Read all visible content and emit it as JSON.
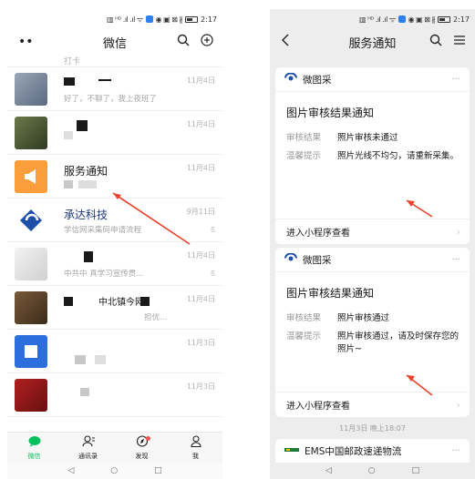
{
  "status": {
    "left_icons": "▥ ᴴᴰ .ıl .ıl ᯤ",
    "right_icons": "◉ ▣ ⊠ ∦",
    "battery": "",
    "time": "2:17"
  },
  "left": {
    "title": "微信",
    "menu_icon": "••",
    "partial_top_text": "打卡",
    "chats": [
      {
        "name": "",
        "preview": "好了，不聊了，我上夜班了",
        "time": "11月4日",
        "muted": false
      },
      {
        "name": "",
        "preview": "",
        "time": "11月4日",
        "muted": false
      },
      {
        "name": "服务通知",
        "preview": "",
        "time": "11月4日",
        "muted": false
      },
      {
        "name": "承达科技",
        "preview": "学信网采集码申请流程",
        "time": "9月11日",
        "muted": true
      },
      {
        "name": "",
        "preview": "中共中   真学习宣传贯...",
        "time": "11月4日",
        "muted": true
      },
      {
        "name": "中北镇今网",
        "preview": "担优...",
        "time": "11月4日",
        "muted": false
      },
      {
        "name": "",
        "preview": "",
        "time": "11月3日",
        "muted": false
      },
      {
        "name": "",
        "preview": "",
        "time": "11月3日",
        "muted": false
      }
    ],
    "tabs": [
      {
        "label": "微信",
        "icon": "chat-bubble-icon",
        "active": true
      },
      {
        "label": "通讯录",
        "icon": "contacts-icon",
        "active": false
      },
      {
        "label": "发现",
        "icon": "compass-icon",
        "active": false
      },
      {
        "label": "我",
        "icon": "person-icon",
        "active": false
      }
    ],
    "nav": [
      "◁",
      "○",
      "□"
    ]
  },
  "right": {
    "title": "服务通知",
    "cards": [
      {
        "source": "微图采",
        "title": "图片审核结果通知",
        "result_label": "审核结果",
        "result_value": "照片审核未通过",
        "tip_label": "温馨提示",
        "tip_value": "照片光线不均匀，请重新采集。",
        "footer": "进入小程序查看"
      },
      {
        "source": "微图采",
        "title": "图片审核结果通知",
        "result_label": "审核结果",
        "result_value": "照片审核通过",
        "tip_label": "温馨提示",
        "tip_value": "照片审核通过，请及时保存您的照片~",
        "footer": "进入小程序查看"
      }
    ],
    "timestamp": "11月3日 晚上18:07",
    "ems_source": "EMS中国邮政速递物流",
    "nav": [
      "◁",
      "○",
      "□"
    ]
  },
  "colors": {
    "accent_green": "#07c160",
    "annotation_red": "#e8412c",
    "service_orange": "#fa9d3b",
    "chengda_blue": "#1e4fa8"
  }
}
